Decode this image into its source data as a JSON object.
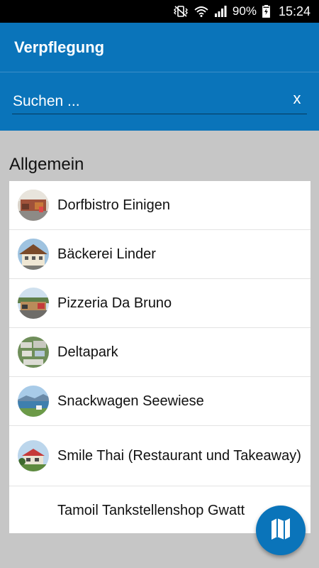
{
  "status_bar": {
    "battery": "90%",
    "time": "15:24",
    "icons": [
      "vibrate-icon",
      "wifi-icon",
      "signal-icon",
      "battery-charging-icon"
    ]
  },
  "app_bar": {
    "title": "Verpflegung"
  },
  "search": {
    "placeholder": "Suchen ...",
    "value": "",
    "clear_label": "x"
  },
  "section": {
    "title": "Allgemein"
  },
  "list": {
    "items": [
      {
        "label": "Dorfbistro Einigen"
      },
      {
        "label": "Bäckerei Linder"
      },
      {
        "label": "Pizzeria Da Bruno"
      },
      {
        "label": "Deltapark"
      },
      {
        "label": "Snackwagen Seewiese"
      },
      {
        "label": "Smile Thai (Restaurant und Takeaway)"
      },
      {
        "label": "Tamoil Tankstellenshop Gwatt"
      }
    ]
  },
  "fab": {
    "icon": "map-icon"
  },
  "colors": {
    "primary": "#0a74ba",
    "background": "#c6c6c6",
    "card": "#ffffff"
  }
}
